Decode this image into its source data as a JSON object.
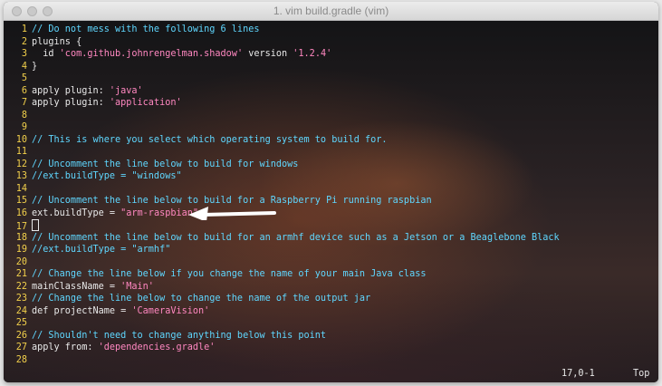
{
  "window": {
    "title": "1. vim build.gradle (vim)"
  },
  "colors": {
    "comment": "#5fd7ff",
    "string": "#ff87c0",
    "line_number": "#f2d04b",
    "text": "#e8e8e8"
  },
  "editor": {
    "lines": [
      {
        "n": "1",
        "segs": [
          {
            "t": "// Do not mess with the following 6 lines",
            "c": "cmt"
          }
        ]
      },
      {
        "n": "2",
        "segs": [
          {
            "t": "plugins {",
            "c": ""
          }
        ]
      },
      {
        "n": "3",
        "segs": [
          {
            "t": "  id ",
            "c": ""
          },
          {
            "t": "'com.github.johnrengelman.shadow'",
            "c": "str"
          },
          {
            "t": " version ",
            "c": ""
          },
          {
            "t": "'1.2.4'",
            "c": "str"
          }
        ]
      },
      {
        "n": "4",
        "segs": [
          {
            "t": "}",
            "c": ""
          }
        ]
      },
      {
        "n": "5",
        "segs": []
      },
      {
        "n": "6",
        "segs": [
          {
            "t": "apply plugin: ",
            "c": ""
          },
          {
            "t": "'java'",
            "c": "str"
          }
        ]
      },
      {
        "n": "7",
        "segs": [
          {
            "t": "apply plugin: ",
            "c": ""
          },
          {
            "t": "'application'",
            "c": "str"
          }
        ]
      },
      {
        "n": "8",
        "segs": []
      },
      {
        "n": "9",
        "segs": []
      },
      {
        "n": "10",
        "segs": [
          {
            "t": "// This is where you select which operating system to build for.",
            "c": "cmt"
          }
        ]
      },
      {
        "n": "11",
        "segs": []
      },
      {
        "n": "12",
        "segs": [
          {
            "t": "// Uncomment the line below to build for windows",
            "c": "cmt"
          }
        ]
      },
      {
        "n": "13",
        "segs": [
          {
            "t": "//ext.buildType = \"windows\"",
            "c": "cmt"
          }
        ]
      },
      {
        "n": "14",
        "segs": []
      },
      {
        "n": "15",
        "segs": [
          {
            "t": "// Uncomment the line below to build for a Raspberry Pi running raspbian",
            "c": "cmt"
          }
        ]
      },
      {
        "n": "16",
        "segs": [
          {
            "t": "ext.buildType = ",
            "c": ""
          },
          {
            "t": "\"arm-raspbian\"",
            "c": "str"
          }
        ]
      },
      {
        "n": "17",
        "segs": [],
        "cursor": true
      },
      {
        "n": "18",
        "segs": [
          {
            "t": "// Uncomment the line below to build for an armhf device such as a Jetson or a Beaglebone Black",
            "c": "cmt"
          }
        ]
      },
      {
        "n": "19",
        "segs": [
          {
            "t": "//ext.buildType = \"armhf\"",
            "c": "cmt"
          }
        ]
      },
      {
        "n": "20",
        "segs": []
      },
      {
        "n": "21",
        "segs": [
          {
            "t": "// Change the line below if you change the name of your main Java class",
            "c": "cmt"
          }
        ]
      },
      {
        "n": "22",
        "segs": [
          {
            "t": "mainClassName = ",
            "c": ""
          },
          {
            "t": "'Main'",
            "c": "str"
          }
        ]
      },
      {
        "n": "23",
        "segs": [
          {
            "t": "// Change the line below to change the name of the output jar",
            "c": "cmt"
          }
        ]
      },
      {
        "n": "24",
        "segs": [
          {
            "t": "def projectName = ",
            "c": ""
          },
          {
            "t": "'CameraVision'",
            "c": "str"
          }
        ]
      },
      {
        "n": "25",
        "segs": []
      },
      {
        "n": "26",
        "segs": [
          {
            "t": "// Shouldn't need to change anything below this point",
            "c": "cmt"
          }
        ]
      },
      {
        "n": "27",
        "segs": [
          {
            "t": "apply from: ",
            "c": ""
          },
          {
            "t": "'dependencies.gradle'",
            "c": "str"
          }
        ]
      },
      {
        "n": "28",
        "segs": []
      }
    ]
  },
  "status": {
    "position": "17,0-1",
    "scroll": "Top"
  }
}
